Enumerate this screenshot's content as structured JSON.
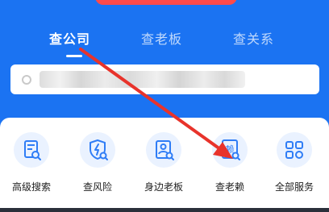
{
  "tabs": [
    {
      "label": "查公司",
      "active": true
    },
    {
      "label": "查老板",
      "active": false
    },
    {
      "label": "查关系",
      "active": false
    }
  ],
  "search": {
    "placeholder": "",
    "icon": "search-icon"
  },
  "services": [
    {
      "label": "高级搜索",
      "icon": "advanced-search-icon"
    },
    {
      "label": "查风险",
      "icon": "risk-shield-icon"
    },
    {
      "label": "身边老板",
      "icon": "nearby-boss-icon"
    },
    {
      "label": "查老赖",
      "icon": "debtor-search-icon",
      "glyph": "赖"
    },
    {
      "label": "全部服务",
      "icon": "all-services-grid-icon"
    }
  ],
  "colors": {
    "brand": "#1b73f2",
    "icon_accent": "#2f7df6",
    "annotation_arrow": "#e8332b"
  }
}
